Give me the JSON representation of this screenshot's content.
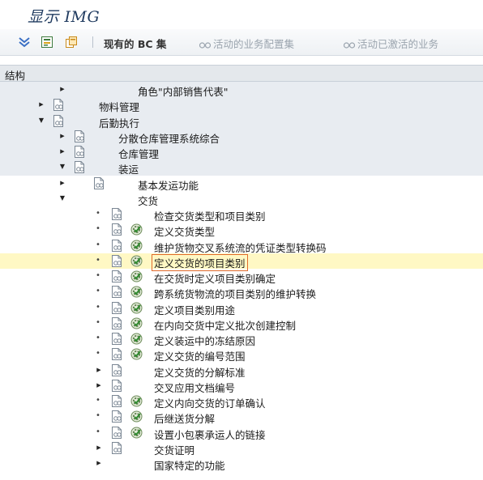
{
  "window": {
    "title": "显示 IMG"
  },
  "toolbar": {
    "existing_bc_sets": "现有的 BC 集",
    "active_bc_sets": "活动的业务配置集",
    "activated_bc_sets": "活动已激活的业务"
  },
  "structure_header": "结构",
  "tree": [
    {
      "level": 3,
      "node": "leaf",
      "docs": false,
      "exec": false,
      "label": "角色\"内部销售代表\"",
      "shaded": true
    },
    {
      "level": 1,
      "node": "collapsed",
      "docs": true,
      "exec": false,
      "label": "物料管理",
      "shaded": true
    },
    {
      "level": 1,
      "node": "expanded",
      "docs": true,
      "exec": false,
      "label": "后勤执行",
      "shaded": true
    },
    {
      "level": 2,
      "node": "collapsed",
      "docs": true,
      "exec": false,
      "label": "分散仓库管理系统综合",
      "shaded": true
    },
    {
      "level": 2,
      "node": "collapsed",
      "docs": true,
      "exec": false,
      "label": "仓库管理",
      "shaded": true
    },
    {
      "level": 2,
      "node": "expanded",
      "docs": true,
      "exec": false,
      "label": "装运",
      "shaded": true
    },
    {
      "level": 3,
      "node": "collapsed",
      "docs": true,
      "exec": false,
      "label": "基本发运功能",
      "shaded": false
    },
    {
      "level": 3,
      "node": "expanded",
      "docs": false,
      "exec": false,
      "label": "交货",
      "shaded": false
    },
    {
      "level": 4,
      "node": "bullet",
      "docs": true,
      "exec": false,
      "label": "检查交货类型和项目类别",
      "shaded": false
    },
    {
      "level": 4,
      "node": "bullet",
      "docs": true,
      "exec": true,
      "label": "定义交货类型",
      "shaded": false
    },
    {
      "level": 4,
      "node": "bullet",
      "docs": true,
      "exec": true,
      "label": "维护货物交叉系统流的凭证类型转换码",
      "shaded": false
    },
    {
      "level": 4,
      "node": "bullet",
      "docs": true,
      "exec": true,
      "label": "定义交货的项目类别",
      "shaded": false,
      "selected": true
    },
    {
      "level": 4,
      "node": "bullet",
      "docs": true,
      "exec": true,
      "label": "在交货时定义项目类别确定",
      "shaded": false
    },
    {
      "level": 4,
      "node": "bullet",
      "docs": true,
      "exec": true,
      "label": "跨系统货物流的项目类别的维护转换",
      "shaded": false
    },
    {
      "level": 4,
      "node": "bullet",
      "docs": true,
      "exec": true,
      "label": "定义项目类别用途",
      "shaded": false
    },
    {
      "level": 4,
      "node": "bullet",
      "docs": true,
      "exec": true,
      "label": "在内向交货中定义批次创建控制",
      "shaded": false
    },
    {
      "level": 4,
      "node": "bullet",
      "docs": true,
      "exec": true,
      "label": "定义装运中的冻结原因",
      "shaded": false
    },
    {
      "level": 4,
      "node": "bullet",
      "docs": true,
      "exec": true,
      "label": "定义交货的编号范围",
      "shaded": false
    },
    {
      "level": 4,
      "node": "collapsed",
      "docs": true,
      "exec": false,
      "label": "定义交货的分解标准",
      "shaded": false
    },
    {
      "level": 4,
      "node": "collapsed",
      "docs": true,
      "exec": false,
      "label": "交叉应用文档编号",
      "shaded": false
    },
    {
      "level": 4,
      "node": "bullet",
      "docs": true,
      "exec": true,
      "label": "定义内向交货的订单确认",
      "shaded": false
    },
    {
      "level": 4,
      "node": "bullet",
      "docs": true,
      "exec": true,
      "label": "后继送货分解",
      "shaded": false
    },
    {
      "level": 4,
      "node": "bullet",
      "docs": true,
      "exec": true,
      "label": "设置小包裹承运人的链接",
      "shaded": false
    },
    {
      "level": 4,
      "node": "collapsed",
      "docs": true,
      "exec": false,
      "label": "交货证明",
      "shaded": false
    },
    {
      "level": 4,
      "node": "collapsed",
      "docs": false,
      "exec": false,
      "label": "国家特定的功能",
      "shaded": false
    }
  ]
}
